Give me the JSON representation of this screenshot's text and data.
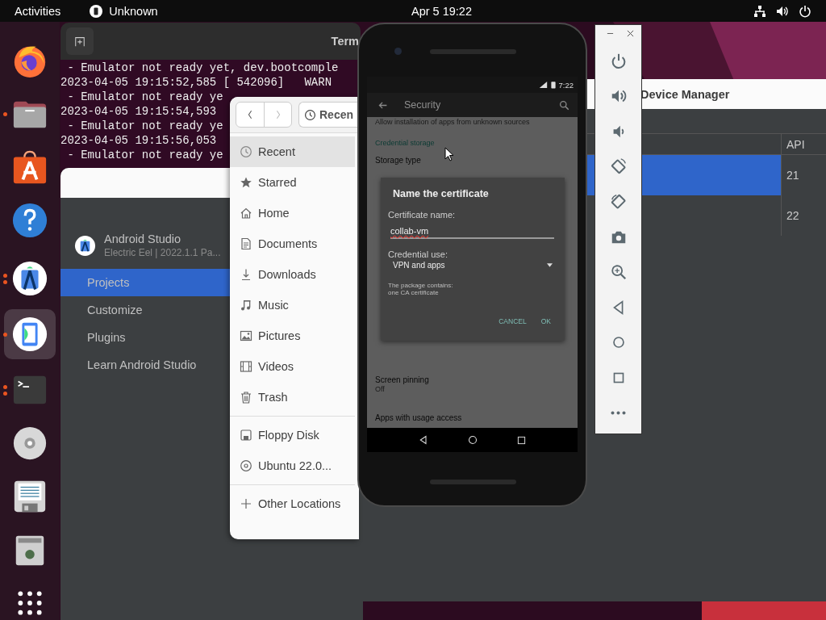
{
  "top_bar": {
    "activities": "Activities",
    "app_name": "Unknown",
    "clock": "Apr 5  19:22"
  },
  "dock": [
    {
      "kind": "firefox",
      "running": false,
      "selected": false
    },
    {
      "kind": "files",
      "running": true,
      "multiple_windows": false,
      "selected": false
    },
    {
      "kind": "software",
      "running": false,
      "selected": false
    },
    {
      "kind": "help",
      "running": false,
      "selected": false
    },
    {
      "kind": "separator"
    },
    {
      "kind": "android-studio",
      "running": true,
      "multiple_windows": true,
      "selected": false
    },
    {
      "kind": "emulator",
      "running": true,
      "multiple_windows": false,
      "selected": true
    },
    {
      "kind": "terminal",
      "running": true,
      "multiple_windows": true,
      "selected": false
    },
    {
      "kind": "disc",
      "running": false,
      "selected": false
    },
    {
      "kind": "floppy",
      "running": false,
      "selected": false
    },
    {
      "kind": "trash",
      "running": false,
      "selected": false
    },
    {
      "kind": "apps",
      "running": false,
      "selected": false
    }
  ],
  "terminal": {
    "title": "Term",
    "lines": [
      " - Emulator not ready yet, dev.bootcomple",
      "2023-04-05 19:15:52,585 [ 542096]   WARN",
      " - Emulator not ready ye",
      "2023-04-05 19:15:54,593",
      " - Emulator not ready ye",
      "2023-04-05 19:15:56,053",
      " - Emulator not ready ye"
    ]
  },
  "device_manager": {
    "title": "Device Manager",
    "columns": [
      "API"
    ],
    "rows": [
      {
        "api": "21",
        "selected": true
      },
      {
        "api": "22",
        "selected": false
      }
    ]
  },
  "android_studio": {
    "app_name": "Android Studio",
    "version": "Electric Eel | 2022.1.1 Pa...",
    "nav": [
      {
        "label": "Projects",
        "selected": true
      },
      {
        "label": "Customize",
        "selected": false
      },
      {
        "label": "Plugins",
        "selected": false
      },
      {
        "label": "Learn Android Studio",
        "selected": false
      }
    ]
  },
  "files": {
    "location": "Recen",
    "sections": [
      [
        {
          "label": "Recent",
          "kind": "recent",
          "selected": true
        },
        {
          "label": "Starred",
          "kind": "starred",
          "selected": false
        },
        {
          "label": "Home",
          "kind": "home",
          "selected": false
        },
        {
          "label": "Documents",
          "kind": "documents",
          "selected": false
        },
        {
          "label": "Downloads",
          "kind": "downloads",
          "selected": false
        },
        {
          "label": "Music",
          "kind": "music",
          "selected": false
        },
        {
          "label": "Pictures",
          "kind": "pictures",
          "selected": false
        },
        {
          "label": "Videos",
          "kind": "videos",
          "selected": false
        },
        {
          "label": "Trash",
          "kind": "trash",
          "selected": false
        }
      ],
      [
        {
          "label": "Floppy Disk",
          "kind": "floppy",
          "selected": false
        },
        {
          "label": "Ubuntu 22.0...",
          "kind": "disc",
          "selected": false
        }
      ],
      [
        {
          "label": "Other Locations",
          "kind": "other",
          "selected": false
        }
      ]
    ]
  },
  "emulator": {
    "status_time": "7:22",
    "screen_title": "Security",
    "settings_above": [
      {
        "text": "Allow installation of apps from unknown sources",
        "kind": "summary"
      },
      {
        "text": "Credential storage",
        "kind": "header"
      },
      {
        "text": "Storage type",
        "kind": "title"
      }
    ],
    "settings_below": [
      {
        "text": "Screen pinning",
        "kind": "title"
      },
      {
        "text": "Off",
        "kind": "summary"
      },
      {
        "text": "Apps with usage access",
        "kind": "title"
      }
    ],
    "dialog": {
      "title": "Name the certificate",
      "name_label": "Certificate name:",
      "name_value": "collab-vm",
      "use_label": "Credential use:",
      "use_value": "VPN and apps",
      "note": [
        "The package contains:",
        "one CA certificate"
      ],
      "buttons": [
        "CANCEL",
        "OK"
      ]
    },
    "tools": [
      {
        "kind": "power"
      },
      {
        "kind": "volume-up"
      },
      {
        "kind": "volume-down"
      },
      {
        "kind": "rotate-left"
      },
      {
        "kind": "rotate-right"
      },
      {
        "kind": "camera"
      },
      {
        "kind": "zoom"
      },
      {
        "kind": "back"
      },
      {
        "kind": "home"
      },
      {
        "kind": "overview"
      },
      {
        "kind": "more"
      }
    ]
  }
}
